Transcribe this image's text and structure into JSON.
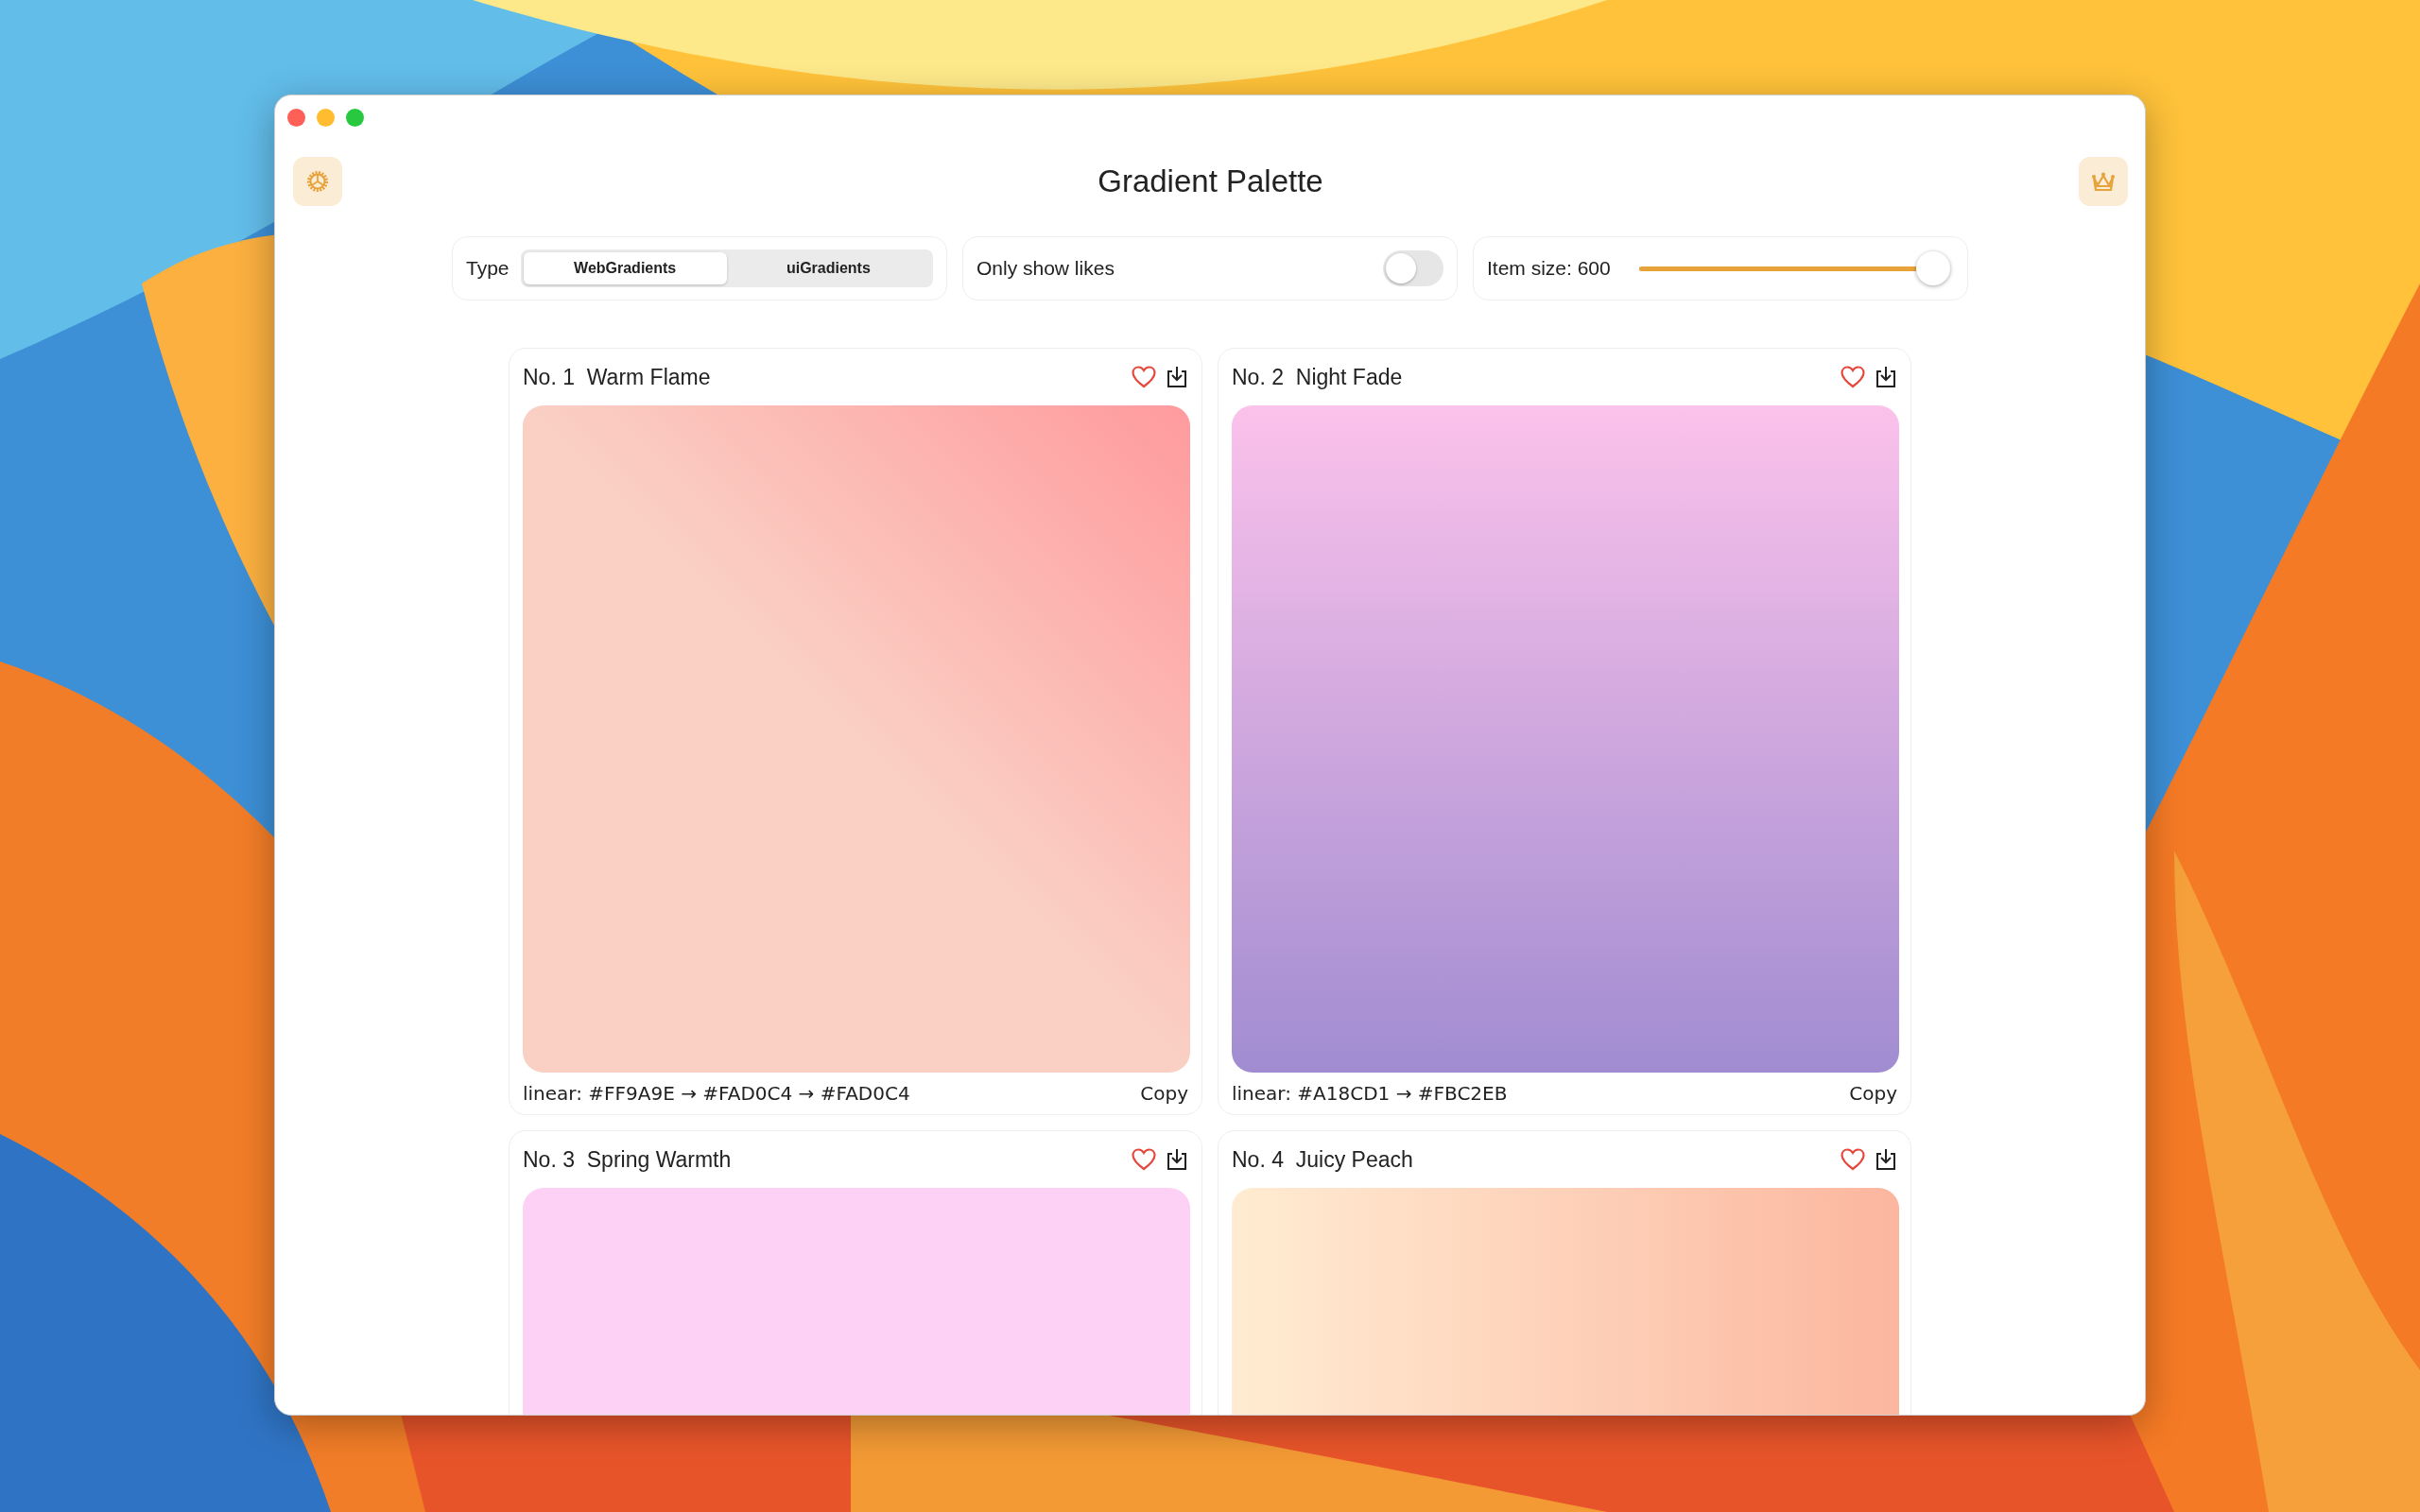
{
  "window": {
    "title": "Gradient Palette"
  },
  "controls": {
    "type_label": "Type",
    "tabs": [
      {
        "label": "WebGradients",
        "selected": true
      },
      {
        "label": "uiGradients",
        "selected": false
      }
    ],
    "likes_label": "Only show likes",
    "likes_on": false,
    "size_label": "Item size: 600",
    "size_slider": {
      "level": 1.0
    }
  },
  "cards": [
    {
      "number": "No. 1",
      "name": "Warm Flame",
      "liked": false,
      "kind": "diagonal",
      "stops": [
        {
          "color": "#ff9a9e"
        },
        {
          "color": "#fad0c4"
        },
        {
          "color": "#fad0c4"
        }
      ],
      "footer": "linear: #FF9A9E → #FAD0C4 → #FAD0C4",
      "copy": "Copy"
    },
    {
      "number": "No. 2",
      "name": "Night Fade",
      "liked": false,
      "kind": "vertical",
      "stops": [
        {
          "color": "#a18cd1"
        },
        {
          "color": "#fbc2eb"
        }
      ],
      "footer": "linear: #A18CD1 → #FBC2EB",
      "copy": "Copy"
    },
    {
      "number": "No. 3",
      "name": "Spring Warmth",
      "liked": false,
      "kind": "vertical",
      "stops": [
        {
          "color": "#fdd1f6"
        }
      ]
    },
    {
      "number": "No. 4",
      "name": "Juicy Peach",
      "liked": false,
      "kind": "horizontal",
      "stops": [
        {
          "color": "#ffecd2"
        },
        {
          "color": "#fcb69f"
        }
      ]
    }
  ]
}
